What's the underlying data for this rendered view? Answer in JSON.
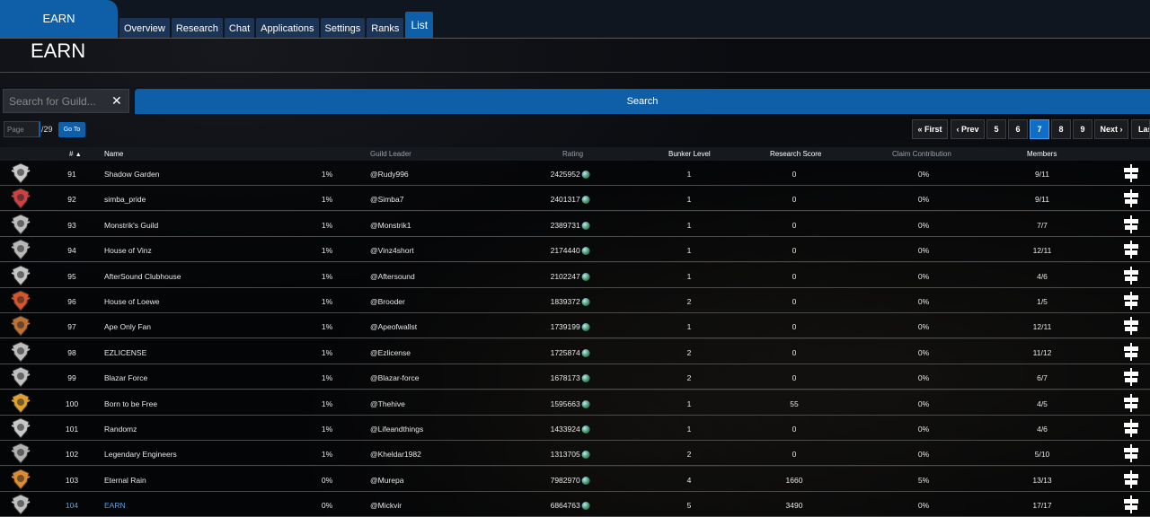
{
  "header": {
    "brand_tab": "EARN",
    "guild_name": "EARN",
    "tabs": [
      "Overview",
      "Research",
      "Chat",
      "Applications",
      "Settings",
      "Ranks",
      "List"
    ],
    "active_tab": "List"
  },
  "search": {
    "placeholder": "Search for Guild...",
    "clear_icon": "close-icon",
    "button": "Search"
  },
  "pagination": {
    "page_placeholder": "Page",
    "total": "/29",
    "goto": "Go To",
    "first": "« First",
    "prev": "‹ Prev",
    "pages": [
      "5",
      "6",
      "7",
      "8",
      "9"
    ],
    "current": "7",
    "next": "Next ›",
    "last": "Last"
  },
  "table": {
    "headers": {
      "rank": "#",
      "name": "Name",
      "leader": "Guild Leader",
      "rating": "Rating",
      "bunker": "Bunker Level",
      "research": "Research Score",
      "claim": "Claim Contribution",
      "members": "Members"
    },
    "rows": [
      {
        "rank": "91",
        "name": "Shadow Garden",
        "pct": "1%",
        "leader": "@Rudy996",
        "rating": "2425952",
        "bunker": "1",
        "research": "0",
        "claim": "0%",
        "members": "9/11"
      },
      {
        "rank": "92",
        "name": "simba_pride",
        "pct": "1%",
        "leader": "@Simba7",
        "rating": "2401317",
        "bunker": "1",
        "research": "0",
        "claim": "0%",
        "members": "9/11"
      },
      {
        "rank": "93",
        "name": "Monstrik's Guild",
        "pct": "1%",
        "leader": "@Monstrik1",
        "rating": "2389731",
        "bunker": "1",
        "research": "0",
        "claim": "0%",
        "members": "7/7"
      },
      {
        "rank": "94",
        "name": "House of Vinz",
        "pct": "1%",
        "leader": "@Vinz4short",
        "rating": "2174440",
        "bunker": "1",
        "research": "0",
        "claim": "0%",
        "members": "12/11"
      },
      {
        "rank": "95",
        "name": "AfterSound Clubhouse",
        "pct": "1%",
        "leader": "@Aftersound",
        "rating": "2102247",
        "bunker": "1",
        "research": "0",
        "claim": "0%",
        "members": "4/6"
      },
      {
        "rank": "96",
        "name": "House of Loewe",
        "pct": "1%",
        "leader": "@Brooder",
        "rating": "1839372",
        "bunker": "2",
        "research": "0",
        "claim": "0%",
        "members": "1/5"
      },
      {
        "rank": "97",
        "name": "Ape Only Fan",
        "pct": "1%",
        "leader": "@Apeofwallst",
        "rating": "1739199",
        "bunker": "1",
        "research": "0",
        "claim": "0%",
        "members": "12/11"
      },
      {
        "rank": "98",
        "name": "EZLICENSE",
        "pct": "1%",
        "leader": "@Ezlicense",
        "rating": "1725874",
        "bunker": "2",
        "research": "0",
        "claim": "0%",
        "members": "11/12"
      },
      {
        "rank": "99",
        "name": "Blazar Force",
        "pct": "1%",
        "leader": "@Blazar-force",
        "rating": "1678173",
        "bunker": "2",
        "research": "0",
        "claim": "0%",
        "members": "6/7"
      },
      {
        "rank": "100",
        "name": "Born to be Free",
        "pct": "1%",
        "leader": "@Thehive",
        "rating": "1595663",
        "bunker": "1",
        "research": "55",
        "claim": "0%",
        "members": "4/5"
      },
      {
        "rank": "101",
        "name": "Randomz",
        "pct": "1%",
        "leader": "@Lifeandthings",
        "rating": "1433924",
        "bunker": "1",
        "research": "0",
        "claim": "0%",
        "members": "4/6"
      },
      {
        "rank": "102",
        "name": "Legendary Engineers",
        "pct": "1%",
        "leader": "@Kheldar1982",
        "rating": "1313705",
        "bunker": "2",
        "research": "0",
        "claim": "0%",
        "members": "5/10"
      },
      {
        "rank": "103",
        "name": "Eternal Rain",
        "pct": "0%",
        "leader": "@Murepa",
        "rating": "7982970",
        "bunker": "4",
        "research": "1660",
        "claim": "5%",
        "members": "13/13"
      },
      {
        "rank": "104",
        "name": "EARN",
        "pct": "0%",
        "leader": "@Mickvir",
        "rating": "6864763",
        "bunker": "5",
        "research": "3490",
        "claim": "0%",
        "members": "17/17",
        "highlight": true
      }
    ]
  },
  "colors": {
    "accent": "#0f5fa8",
    "highlight_text": "#5aa0e0"
  },
  "icons": {
    "emblem": "guild-emblem-icon",
    "rating": "rating-orb-icon",
    "action": "view-guild-icon",
    "sort": "sort-asc-icon"
  }
}
